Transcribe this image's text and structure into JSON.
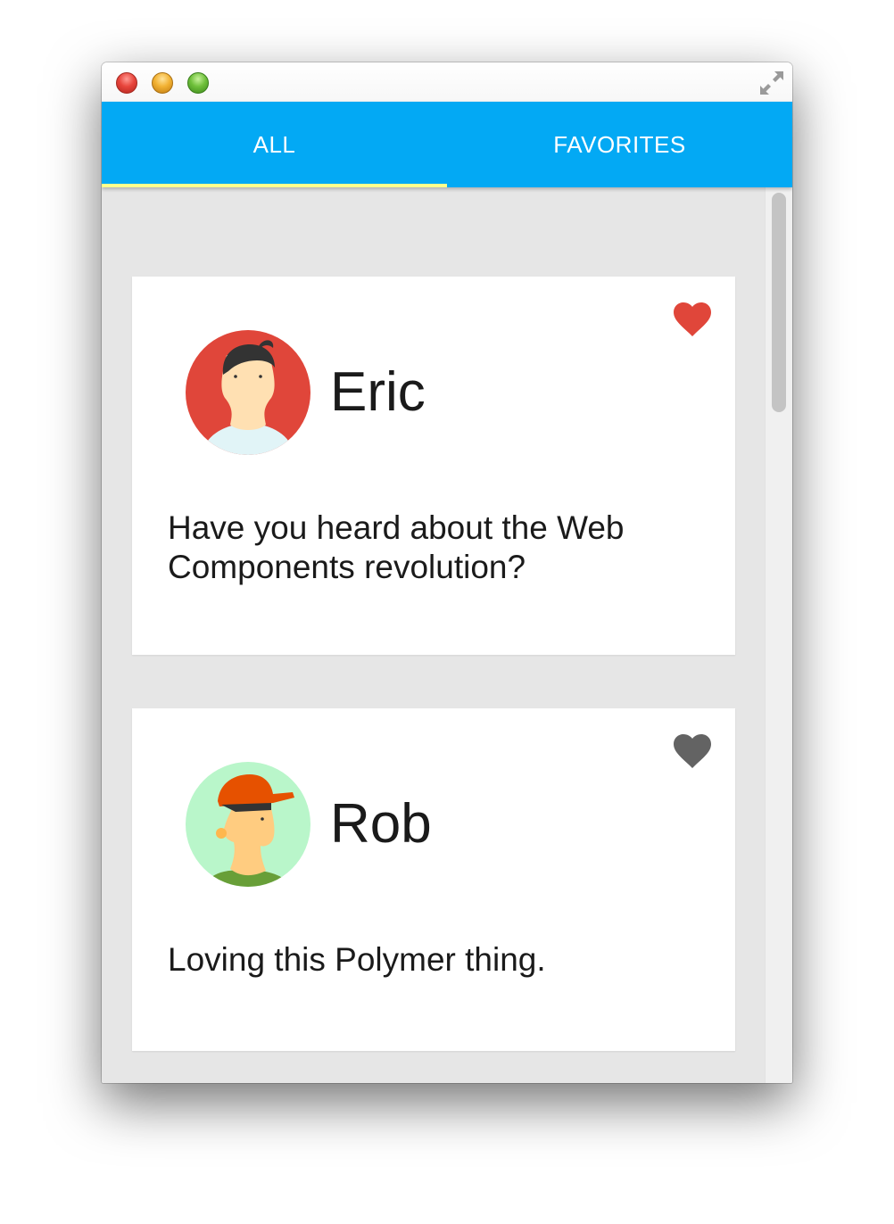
{
  "tabs": [
    {
      "label": "ALL",
      "selected": true
    },
    {
      "label": "FAVORITES",
      "selected": false
    }
  ],
  "colors": {
    "accent": "#03a9f4",
    "tab_indicator": "#ffff8d",
    "favorite_active": "#e0463a",
    "favorite_inactive": "#636363",
    "content_background": "#e6e6e6"
  },
  "posts": [
    {
      "name": "Eric",
      "message": "Have you heard about the Web Components revolution?",
      "favorite": true,
      "avatar_icon": "avatar-eric-icon"
    },
    {
      "name": "Rob",
      "message": "Loving this Polymer thing.",
      "favorite": false,
      "avatar_icon": "avatar-rob-icon"
    }
  ]
}
